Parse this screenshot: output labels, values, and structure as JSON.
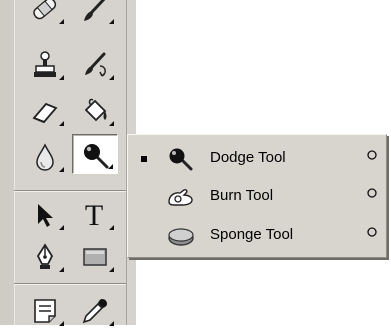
{
  "toolbox": {
    "tools": [
      {
        "id": "healing-brush",
        "icon": "bandage-icon",
        "has_flyout": true
      },
      {
        "id": "brush",
        "icon": "brush-icon",
        "has_flyout": true
      },
      {
        "id": "clone-stamp",
        "icon": "stamp-icon",
        "has_flyout": true
      },
      {
        "id": "history-brush",
        "icon": "history-brush-icon",
        "has_flyout": true
      },
      {
        "id": "eraser",
        "icon": "eraser-icon",
        "has_flyout": true
      },
      {
        "id": "paint-bucket",
        "icon": "paint-bucket-icon",
        "has_flyout": true
      },
      {
        "id": "blur",
        "icon": "water-drop-icon",
        "has_flyout": true
      },
      {
        "id": "dodge",
        "icon": "dodge-icon",
        "has_flyout": true,
        "active": true
      },
      {
        "id": "path-selection",
        "icon": "arrow-pointer-icon",
        "has_flyout": true
      },
      {
        "id": "type",
        "icon": "type-icon",
        "glyph": "T",
        "has_flyout": true
      },
      {
        "id": "pen",
        "icon": "pen-nib-icon",
        "has_flyout": true
      },
      {
        "id": "rectangle",
        "icon": "rectangle-icon",
        "has_flyout": true
      },
      {
        "id": "notes",
        "icon": "notes-icon",
        "has_flyout": true
      },
      {
        "id": "eyedropper",
        "icon": "eyedropper-icon",
        "has_flyout": true
      }
    ]
  },
  "flyout": {
    "items": [
      {
        "label": "Dodge Tool",
        "shortcut": "O",
        "selected": true,
        "icon": "dodge-icon"
      },
      {
        "label": "Burn Tool",
        "shortcut": "O",
        "selected": false,
        "icon": "burn-hand-icon"
      },
      {
        "label": "Sponge Tool",
        "shortcut": "O",
        "selected": false,
        "icon": "sponge-icon"
      }
    ]
  }
}
